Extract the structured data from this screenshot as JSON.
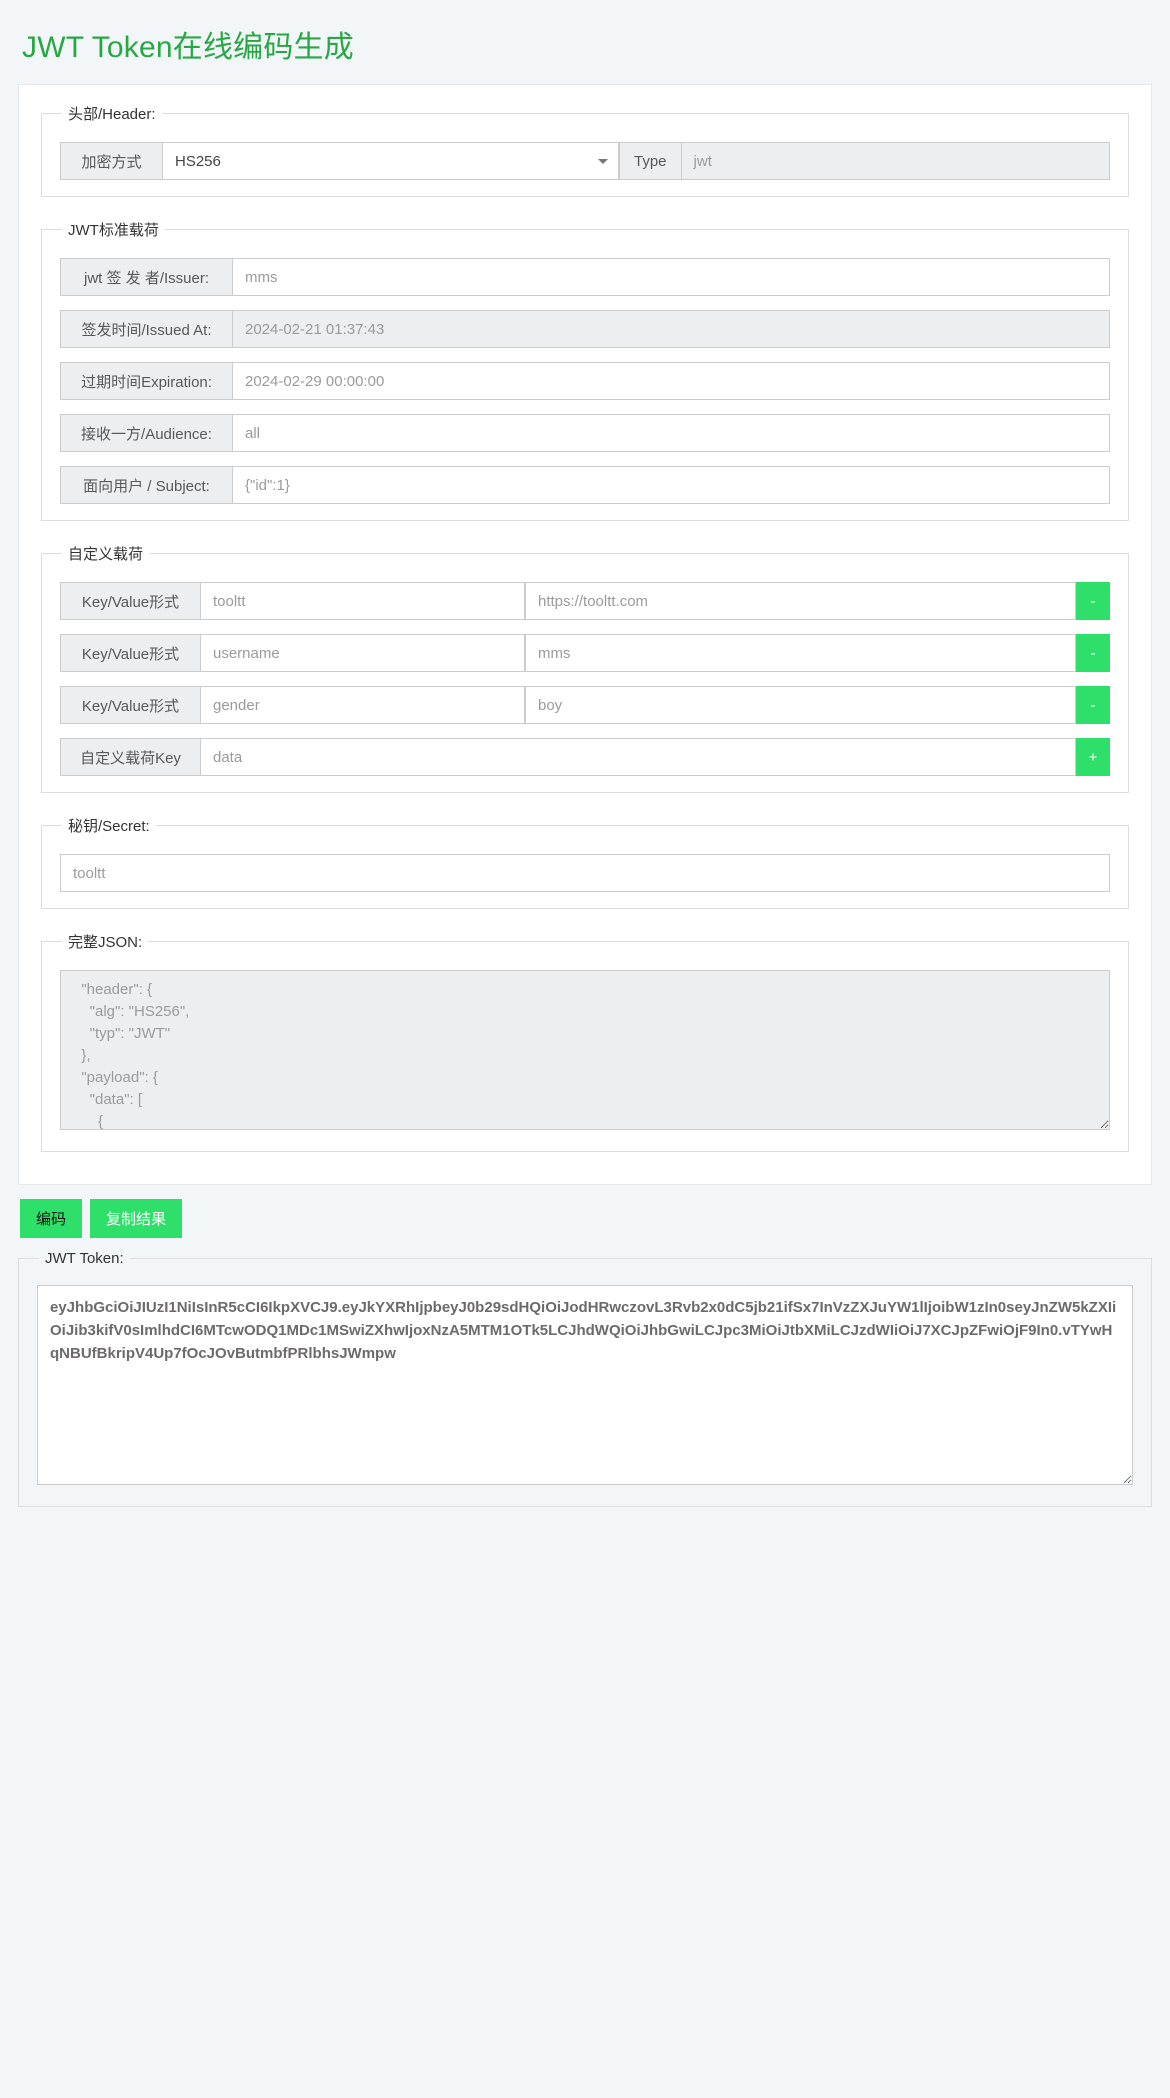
{
  "page": {
    "title": "JWT Token在线编码生成",
    "accent": "#28a745",
    "button_green": "#2ee06a"
  },
  "header_section": {
    "legend": "头部/Header:",
    "alg_label": "加密方式",
    "alg_value": "HS256",
    "type_label": "Type",
    "type_value": "jwt"
  },
  "standard_payload": {
    "legend": "JWT标准载荷",
    "rows": [
      {
        "label": "jwt 签 发 者/Issuer:",
        "value": "mms",
        "disabled": false
      },
      {
        "label": "签发时间/Issued At:",
        "value": "2024-02-21 01:37:43",
        "disabled": true
      },
      {
        "label": "过期时间Expiration:",
        "value": "2024-02-29 00:00:00",
        "disabled": false
      },
      {
        "label": "接收一方/Audience:",
        "value": "all",
        "disabled": false
      },
      {
        "label": "面向用户 / Subject:",
        "value": "{\"id\":1}",
        "disabled": false
      }
    ]
  },
  "custom_payload": {
    "legend": "自定义载荷",
    "kv_label": "Key/Value形式",
    "remove_label": "-",
    "add_label": "+",
    "rows": [
      {
        "key": "tooltt",
        "value": "https://tooltt.com"
      },
      {
        "key": "username",
        "value": "mms"
      },
      {
        "key": "gender",
        "value": "boy"
      }
    ],
    "add_row": {
      "label": "自定义载荷Key",
      "value": "data"
    }
  },
  "secret": {
    "legend": "秘钥/Secret:",
    "value": "tooltt"
  },
  "full_json": {
    "legend": "完整JSON:",
    "value": "  \"header\": {\n    \"alg\": \"HS256\",\n    \"typ\": \"JWT\"\n  },\n  \"payload\": {\n    \"data\": [\n      {"
  },
  "actions": {
    "encode_label": "编码",
    "copy_label": "复制结果"
  },
  "token": {
    "legend": "JWT Token:",
    "value": "eyJhbGciOiJIUzI1NiIsInR5cCI6IkpXVCJ9.eyJkYXRhIjpbeyJ0b29sdHQiOiJodHRwczovL3Rvb2x0dC5jb21ifSx7InVzZXJuYW1lIjoibW1zIn0seyJnZW5kZXIiOiJib3kifV0sImlhdCI6MTcwODQ1MDc1MSwiZXhwIjoxNzA5MTM1OTk5LCJhdWQiOiJhbGwiLCJpc3MiOiJtbXMiLCJzdWIiOiJ7XCJpZFwiOjF9In0.vTYwHqNBUfBkripV4Up7fOcJOvButmbfPRlbhsJWmpw"
  }
}
